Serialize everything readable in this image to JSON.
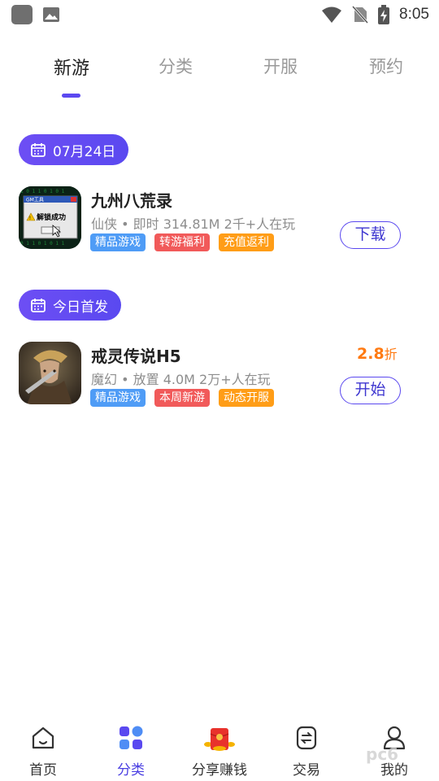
{
  "status_bar": {
    "time": "8:05"
  },
  "tabs": [
    {
      "label": "新游",
      "active": true
    },
    {
      "label": "分类",
      "active": false
    },
    {
      "label": "开服",
      "active": false
    },
    {
      "label": "预约",
      "active": false
    }
  ],
  "sections": [
    {
      "date_label": "07月24日",
      "game": {
        "title": "九州八荒录",
        "meta": "仙侠 • 即时  314.81M 2千+人在玩",
        "tags": [
          "精品游戏",
          "转游福利",
          "充值返利"
        ],
        "button": "下载",
        "icon_text": {
          "window_title": "GM工具",
          "message": "解锁成功"
        }
      }
    },
    {
      "date_label": "今日首发",
      "game": {
        "title": "戒灵传说H5",
        "meta": "魔幻 • 放置  4.0M 2万+人在玩",
        "tags": [
          "精品游戏",
          "本周新游",
          "动态开服"
        ],
        "button": "开始",
        "discount_value": "2.8",
        "discount_unit": "折"
      }
    }
  ],
  "bottom_nav": [
    {
      "label": "首页",
      "icon": "home-icon",
      "active": false
    },
    {
      "label": "分类",
      "icon": "category-icon",
      "active": true
    },
    {
      "label": "分享赚钱",
      "icon": "red-envelope-icon",
      "active": false
    },
    {
      "label": "交易",
      "icon": "trade-icon",
      "active": false
    },
    {
      "label": "我的",
      "icon": "profile-icon",
      "active": false
    }
  ],
  "watermark": "pc6",
  "colors": {
    "accent": "#5a49f0",
    "tag_blue": "#4f9cf6",
    "tag_red": "#f15a5a",
    "tag_orange": "#ff9d17",
    "discount": "#ff7a12"
  }
}
